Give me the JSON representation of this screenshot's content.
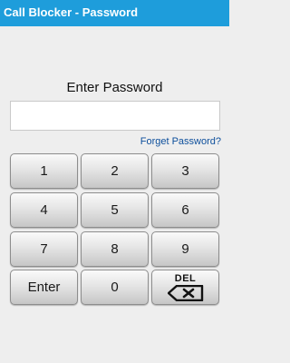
{
  "titlebar": {
    "title": "Call Blocker - Password"
  },
  "prompt": "Enter Password",
  "password": {
    "value": "",
    "placeholder": ""
  },
  "forgot_link": "Forget Password?",
  "keypad": {
    "row1": [
      "1",
      "2",
      "3"
    ],
    "row2": [
      "4",
      "5",
      "6"
    ],
    "row3": [
      "7",
      "8",
      "9"
    ],
    "enter": "Enter",
    "zero": "0",
    "del_label": "DEL"
  },
  "colors": {
    "titlebar": "#1e9ddb",
    "link": "#0d4f9c",
    "background": "#eeeeee"
  },
  "icons": {
    "delete": "backspace-icon"
  }
}
